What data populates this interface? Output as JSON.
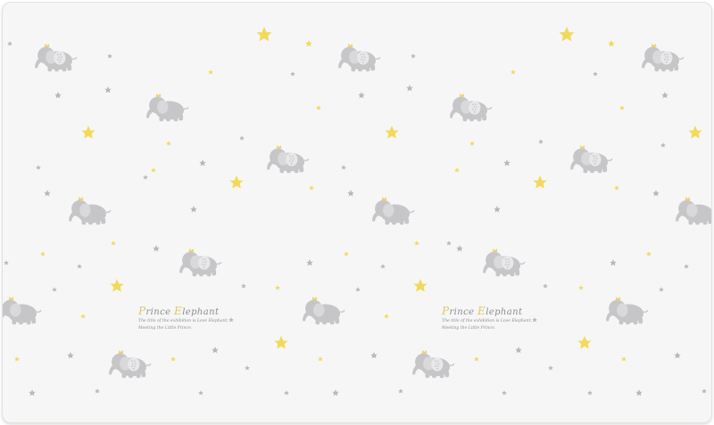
{
  "colors": {
    "background": "#f6f6f7",
    "elephant": "#c4c4c6",
    "star_yellow": "#f2d95a",
    "star_grey": "#b8b8bb",
    "crown": "#f0d060"
  },
  "icons": {
    "elephant": "elephant-icon",
    "star": "star-icon"
  },
  "brand_blocks": [
    {
      "title_initial_1": "P",
      "title_rest_1": "rince ",
      "title_initial_2": "E",
      "title_rest_2": "lephant",
      "line_1": "The title of the exhibition is Love Elephant,",
      "line_2": "Meeting the Little Prince."
    },
    {
      "title_initial_1": "P",
      "title_rest_1": "rince ",
      "title_initial_2": "E",
      "title_rest_2": "lephant",
      "line_1": "The title of the exhibition is Love Elephant,",
      "line_2": "Meeting the Little Prince."
    }
  ]
}
